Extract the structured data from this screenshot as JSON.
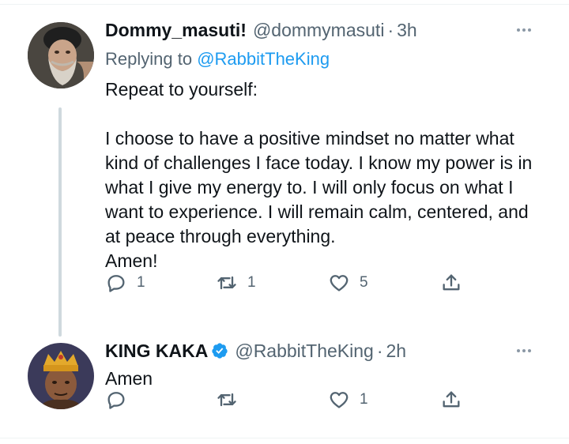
{
  "tweets": [
    {
      "display_name": "Dommy_masuti!",
      "handle": "@dommymasuti",
      "separator": "·",
      "time": "3h",
      "replying_prefix": "Replying to",
      "replying_to": "@RabbitTheKing",
      "text": "Repeat to yourself:\n\nI choose to have a positive mindset no matter what kind of challenges I face today. I know my power is in what I give my energy to. I will only focus on what I want to experience. I will remain calm, centered, and at peace through everything.\nAmen!",
      "reply_count": "1",
      "retweet_count": "1",
      "like_count": "5",
      "avatar_icon": "elderly-man-avatar"
    },
    {
      "display_name": "KING KAKA",
      "verified": true,
      "handle": "@RabbitTheKing",
      "separator": "·",
      "time": "2h",
      "text": "Amen",
      "reply_count": "",
      "retweet_count": "",
      "like_count": "1",
      "avatar_icon": "crowned-man-avatar"
    }
  ],
  "colors": {
    "link": "#1d9bf0",
    "secondary_text": "#536471",
    "thread_line": "#cfd9de",
    "verified": "#1d9bf0"
  }
}
